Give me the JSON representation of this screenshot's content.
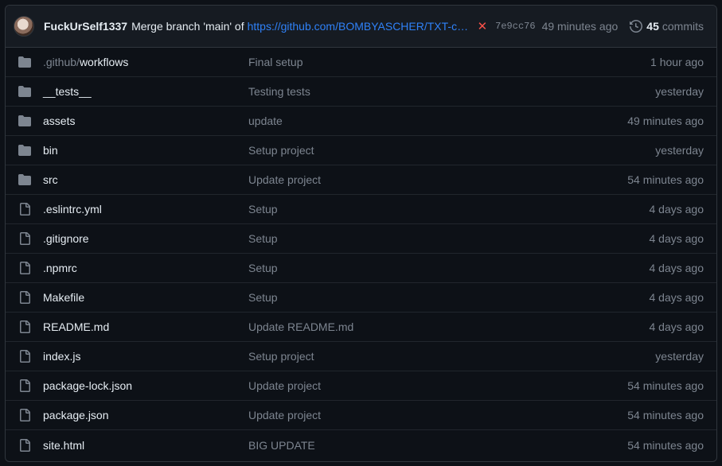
{
  "commit": {
    "author": "FuckUrSelf1337",
    "message": "Merge branch 'main' of",
    "link": "https://github.com/BOMBYASCHER/TXT-co...",
    "status_icon": "x-icon",
    "status_color": "#f85149",
    "sha": "7e9cc76",
    "time": "49 minutes ago",
    "commit_count": "45",
    "commits_label": "commits"
  },
  "files": [
    {
      "type": "folder",
      "prefix": ".github/",
      "name": "workflows",
      "message": "Final setup",
      "age": "1 hour ago"
    },
    {
      "type": "folder",
      "prefix": "",
      "name": "__tests__",
      "message": "Testing tests",
      "age": "yesterday"
    },
    {
      "type": "folder",
      "prefix": "",
      "name": "assets",
      "message": "update",
      "age": "49 minutes ago"
    },
    {
      "type": "folder",
      "prefix": "",
      "name": "bin",
      "message": "Setup project",
      "age": "yesterday"
    },
    {
      "type": "folder",
      "prefix": "",
      "name": "src",
      "message": "Update project",
      "age": "54 minutes ago"
    },
    {
      "type": "file",
      "prefix": "",
      "name": ".eslintrc.yml",
      "message": "Setup",
      "age": "4 days ago"
    },
    {
      "type": "file",
      "prefix": "",
      "name": ".gitignore",
      "message": "Setup",
      "age": "4 days ago"
    },
    {
      "type": "file",
      "prefix": "",
      "name": ".npmrc",
      "message": "Setup",
      "age": "4 days ago"
    },
    {
      "type": "file",
      "prefix": "",
      "name": "Makefile",
      "message": "Setup",
      "age": "4 days ago"
    },
    {
      "type": "file",
      "prefix": "",
      "name": "README.md",
      "message": "Update README.md",
      "age": "4 days ago"
    },
    {
      "type": "file",
      "prefix": "",
      "name": "index.js",
      "message": "Setup project",
      "age": "yesterday"
    },
    {
      "type": "file",
      "prefix": "",
      "name": "package-lock.json",
      "message": "Update project",
      "age": "54 minutes ago"
    },
    {
      "type": "file",
      "prefix": "",
      "name": "package.json",
      "message": "Update project",
      "age": "54 minutes ago"
    },
    {
      "type": "file",
      "prefix": "",
      "name": "site.html",
      "message": "BIG UPDATE",
      "age": "54 minutes ago"
    }
  ]
}
